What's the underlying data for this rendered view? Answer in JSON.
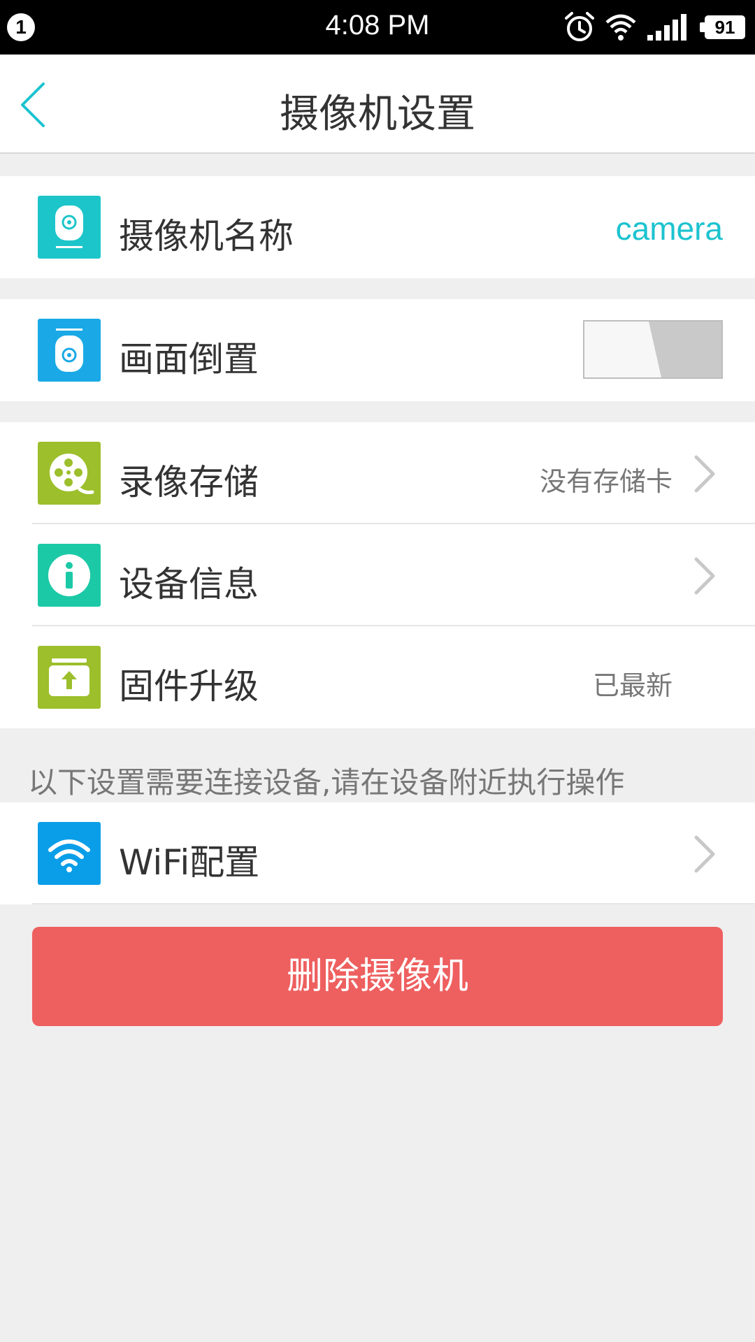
{
  "status_bar": {
    "notification_count": "1",
    "time": "4:08 PM",
    "battery": "91",
    "icons": [
      "alarm-icon",
      "wifi-icon",
      "signal-icon",
      "battery-icon"
    ]
  },
  "header": {
    "title": "摄像机设置",
    "back_icon": "chevron-left-icon"
  },
  "settings": {
    "camera_name": {
      "label": "摄像机名称",
      "value": "camera",
      "icon": "camera-icon",
      "color": "#1cc5c9"
    },
    "flip": {
      "label": "画面倒置",
      "icon": "camera-flip-icon",
      "color": "#1aa9e6",
      "toggle_on": false
    },
    "recording": {
      "label": "录像存储",
      "value": "没有存储卡",
      "icon": "film-reel-icon",
      "color": "#9cbf2b"
    },
    "device_info": {
      "label": "设备信息",
      "icon": "info-icon",
      "color": "#1cc9a6"
    },
    "firmware": {
      "label": "固件升级",
      "value": "已最新",
      "icon": "upload-icon",
      "color": "#9cbf2b"
    }
  },
  "section_note": "以下设置需要连接设备,请在设备附近执行操作",
  "wifi_config": {
    "label": "WiFi配置",
    "icon": "wifi-icon",
    "color": "#0a9ee8"
  },
  "delete_button": {
    "label": "删除摄像机",
    "color": "#ee5f5f"
  },
  "colors": {
    "accent": "#1cc3cf",
    "background": "#efefef"
  }
}
